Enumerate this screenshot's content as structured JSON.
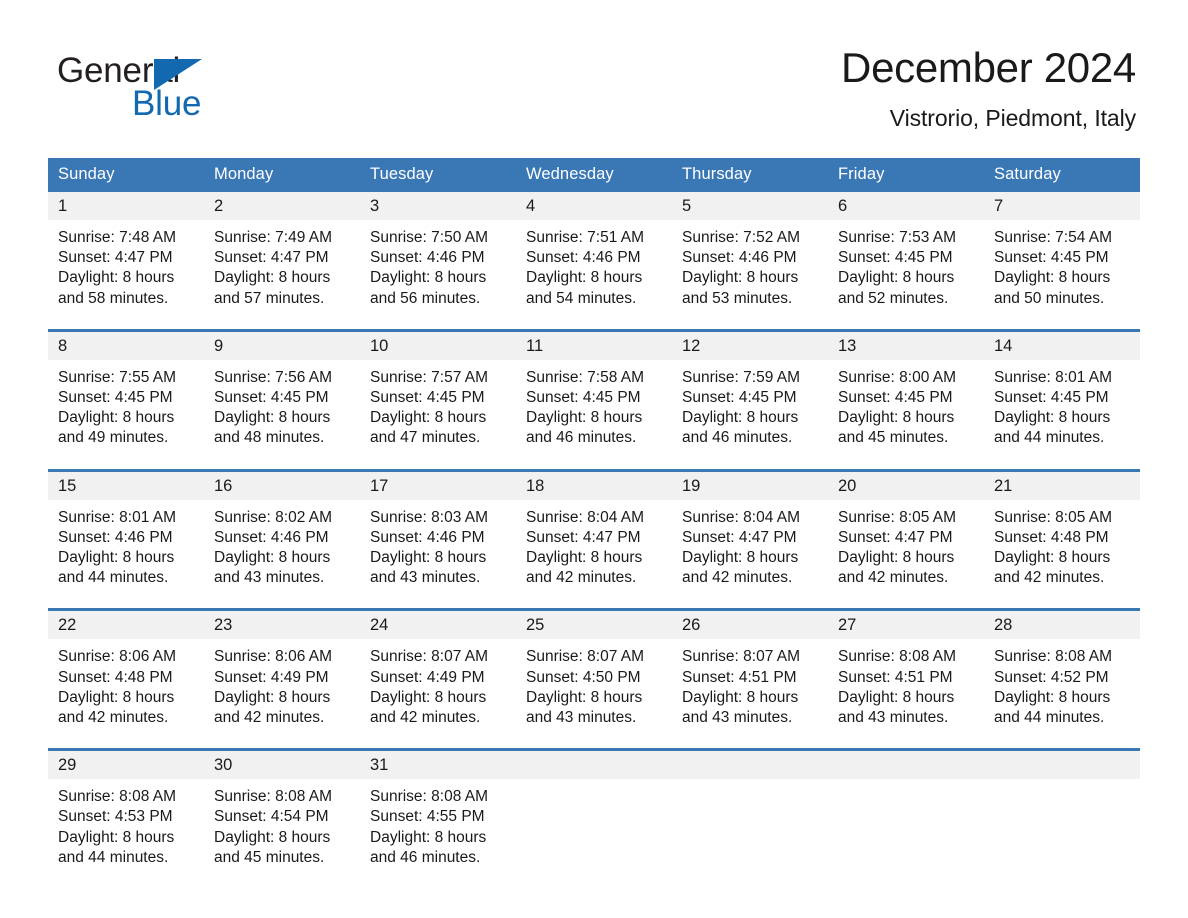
{
  "brand": {
    "name_part1": "General",
    "name_part2": "Blue",
    "triangle_color": "#1269b0"
  },
  "header": {
    "title": "December 2024",
    "subtitle": "Vistrorio, Piedmont, Italy"
  },
  "theme": {
    "header_blue": "#3a77b5",
    "daynum_gray": "#f1f1f1",
    "text": "#1a1a1a"
  },
  "weekday_headers": [
    "Sunday",
    "Monday",
    "Tuesday",
    "Wednesday",
    "Thursday",
    "Friday",
    "Saturday"
  ],
  "weeks": [
    {
      "days": [
        {
          "num": "1",
          "sunrise": "Sunrise: 7:48 AM",
          "sunset": "Sunset: 4:47 PM",
          "daylight1": "Daylight: 8 hours",
          "daylight2": "and 58 minutes."
        },
        {
          "num": "2",
          "sunrise": "Sunrise: 7:49 AM",
          "sunset": "Sunset: 4:47 PM",
          "daylight1": "Daylight: 8 hours",
          "daylight2": "and 57 minutes."
        },
        {
          "num": "3",
          "sunrise": "Sunrise: 7:50 AM",
          "sunset": "Sunset: 4:46 PM",
          "daylight1": "Daylight: 8 hours",
          "daylight2": "and 56 minutes."
        },
        {
          "num": "4",
          "sunrise": "Sunrise: 7:51 AM",
          "sunset": "Sunset: 4:46 PM",
          "daylight1": "Daylight: 8 hours",
          "daylight2": "and 54 minutes."
        },
        {
          "num": "5",
          "sunrise": "Sunrise: 7:52 AM",
          "sunset": "Sunset: 4:46 PM",
          "daylight1": "Daylight: 8 hours",
          "daylight2": "and 53 minutes."
        },
        {
          "num": "6",
          "sunrise": "Sunrise: 7:53 AM",
          "sunset": "Sunset: 4:45 PM",
          "daylight1": "Daylight: 8 hours",
          "daylight2": "and 52 minutes."
        },
        {
          "num": "7",
          "sunrise": "Sunrise: 7:54 AM",
          "sunset": "Sunset: 4:45 PM",
          "daylight1": "Daylight: 8 hours",
          "daylight2": "and 50 minutes."
        }
      ]
    },
    {
      "days": [
        {
          "num": "8",
          "sunrise": "Sunrise: 7:55 AM",
          "sunset": "Sunset: 4:45 PM",
          "daylight1": "Daylight: 8 hours",
          "daylight2": "and 49 minutes."
        },
        {
          "num": "9",
          "sunrise": "Sunrise: 7:56 AM",
          "sunset": "Sunset: 4:45 PM",
          "daylight1": "Daylight: 8 hours",
          "daylight2": "and 48 minutes."
        },
        {
          "num": "10",
          "sunrise": "Sunrise: 7:57 AM",
          "sunset": "Sunset: 4:45 PM",
          "daylight1": "Daylight: 8 hours",
          "daylight2": "and 47 minutes."
        },
        {
          "num": "11",
          "sunrise": "Sunrise: 7:58 AM",
          "sunset": "Sunset: 4:45 PM",
          "daylight1": "Daylight: 8 hours",
          "daylight2": "and 46 minutes."
        },
        {
          "num": "12",
          "sunrise": "Sunrise: 7:59 AM",
          "sunset": "Sunset: 4:45 PM",
          "daylight1": "Daylight: 8 hours",
          "daylight2": "and 46 minutes."
        },
        {
          "num": "13",
          "sunrise": "Sunrise: 8:00 AM",
          "sunset": "Sunset: 4:45 PM",
          "daylight1": "Daylight: 8 hours",
          "daylight2": "and 45 minutes."
        },
        {
          "num": "14",
          "sunrise": "Sunrise: 8:01 AM",
          "sunset": "Sunset: 4:45 PM",
          "daylight1": "Daylight: 8 hours",
          "daylight2": "and 44 minutes."
        }
      ]
    },
    {
      "days": [
        {
          "num": "15",
          "sunrise": "Sunrise: 8:01 AM",
          "sunset": "Sunset: 4:46 PM",
          "daylight1": "Daylight: 8 hours",
          "daylight2": "and 44 minutes."
        },
        {
          "num": "16",
          "sunrise": "Sunrise: 8:02 AM",
          "sunset": "Sunset: 4:46 PM",
          "daylight1": "Daylight: 8 hours",
          "daylight2": "and 43 minutes."
        },
        {
          "num": "17",
          "sunrise": "Sunrise: 8:03 AM",
          "sunset": "Sunset: 4:46 PM",
          "daylight1": "Daylight: 8 hours",
          "daylight2": "and 43 minutes."
        },
        {
          "num": "18",
          "sunrise": "Sunrise: 8:04 AM",
          "sunset": "Sunset: 4:47 PM",
          "daylight1": "Daylight: 8 hours",
          "daylight2": "and 42 minutes."
        },
        {
          "num": "19",
          "sunrise": "Sunrise: 8:04 AM",
          "sunset": "Sunset: 4:47 PM",
          "daylight1": "Daylight: 8 hours",
          "daylight2": "and 42 minutes."
        },
        {
          "num": "20",
          "sunrise": "Sunrise: 8:05 AM",
          "sunset": "Sunset: 4:47 PM",
          "daylight1": "Daylight: 8 hours",
          "daylight2": "and 42 minutes."
        },
        {
          "num": "21",
          "sunrise": "Sunrise: 8:05 AM",
          "sunset": "Sunset: 4:48 PM",
          "daylight1": "Daylight: 8 hours",
          "daylight2": "and 42 minutes."
        }
      ]
    },
    {
      "days": [
        {
          "num": "22",
          "sunrise": "Sunrise: 8:06 AM",
          "sunset": "Sunset: 4:48 PM",
          "daylight1": "Daylight: 8 hours",
          "daylight2": "and 42 minutes."
        },
        {
          "num": "23",
          "sunrise": "Sunrise: 8:06 AM",
          "sunset": "Sunset: 4:49 PM",
          "daylight1": "Daylight: 8 hours",
          "daylight2": "and 42 minutes."
        },
        {
          "num": "24",
          "sunrise": "Sunrise: 8:07 AM",
          "sunset": "Sunset: 4:49 PM",
          "daylight1": "Daylight: 8 hours",
          "daylight2": "and 42 minutes."
        },
        {
          "num": "25",
          "sunrise": "Sunrise: 8:07 AM",
          "sunset": "Sunset: 4:50 PM",
          "daylight1": "Daylight: 8 hours",
          "daylight2": "and 43 minutes."
        },
        {
          "num": "26",
          "sunrise": "Sunrise: 8:07 AM",
          "sunset": "Sunset: 4:51 PM",
          "daylight1": "Daylight: 8 hours",
          "daylight2": "and 43 minutes."
        },
        {
          "num": "27",
          "sunrise": "Sunrise: 8:08 AM",
          "sunset": "Sunset: 4:51 PM",
          "daylight1": "Daylight: 8 hours",
          "daylight2": "and 43 minutes."
        },
        {
          "num": "28",
          "sunrise": "Sunrise: 8:08 AM",
          "sunset": "Sunset: 4:52 PM",
          "daylight1": "Daylight: 8 hours",
          "daylight2": "and 44 minutes."
        }
      ]
    },
    {
      "days": [
        {
          "num": "29",
          "sunrise": "Sunrise: 8:08 AM",
          "sunset": "Sunset: 4:53 PM",
          "daylight1": "Daylight: 8 hours",
          "daylight2": "and 44 minutes."
        },
        {
          "num": "30",
          "sunrise": "Sunrise: 8:08 AM",
          "sunset": "Sunset: 4:54 PM",
          "daylight1": "Daylight: 8 hours",
          "daylight2": "and 45 minutes."
        },
        {
          "num": "31",
          "sunrise": "Sunrise: 8:08 AM",
          "sunset": "Sunset: 4:55 PM",
          "daylight1": "Daylight: 8 hours",
          "daylight2": "and 46 minutes."
        },
        {
          "num": "",
          "sunrise": "",
          "sunset": "",
          "daylight1": "",
          "daylight2": ""
        },
        {
          "num": "",
          "sunrise": "",
          "sunset": "",
          "daylight1": "",
          "daylight2": ""
        },
        {
          "num": "",
          "sunrise": "",
          "sunset": "",
          "daylight1": "",
          "daylight2": ""
        },
        {
          "num": "",
          "sunrise": "",
          "sunset": "",
          "daylight1": "",
          "daylight2": ""
        }
      ]
    }
  ]
}
